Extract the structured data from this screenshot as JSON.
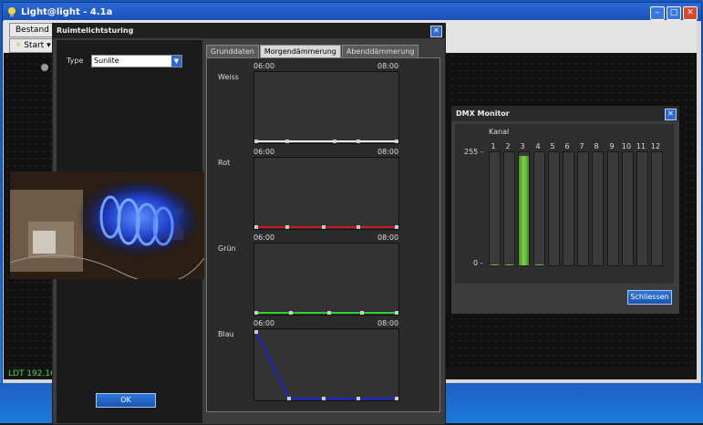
{
  "app": {
    "title": "Light@light - 4.1a"
  },
  "menubar": {
    "bestand_label": "Bestand",
    "start_label": "Start"
  },
  "status": {
    "ip": "LDT 192.168"
  },
  "dialog": {
    "title": "Ruimtelichtsturing",
    "type_label": "Type",
    "type_value": "Sunlite",
    "ok_label": "OK",
    "tabs": [
      "Grunddaten",
      "Morgendämmerung",
      "Abenddämmerung"
    ],
    "active_tab": 1,
    "channels": [
      {
        "name": "Weiss",
        "start": "06:00",
        "end": "08:00",
        "color": "#ffffff",
        "levels": [
          0,
          0,
          0,
          0,
          0
        ]
      },
      {
        "name": "Rot",
        "start": "06:00",
        "end": "08:00",
        "color": "#d01818",
        "levels": [
          0,
          0,
          0,
          0,
          0
        ]
      },
      {
        "name": "Grün",
        "start": "06:00",
        "end": "08:00",
        "color": "#2ad12a",
        "levels": [
          0,
          0,
          0,
          0,
          0
        ]
      },
      {
        "name": "Blau",
        "start": "06:00",
        "end": "08:00",
        "color": "#1a26d6",
        "levels": [
          1,
          0,
          0,
          0,
          0,
          0
        ]
      }
    ]
  },
  "dmx": {
    "title": "DMX Monitor",
    "kanal_label": "Kanal",
    "max_label": "255 -",
    "min_label": "0 -",
    "close_label": "Schliessen",
    "channels": [
      {
        "num": "1",
        "level": 0.01
      },
      {
        "num": "2",
        "level": 0.01
      },
      {
        "num": "3",
        "level": 0.97
      },
      {
        "num": "4",
        "level": 0.01
      },
      {
        "num": "5",
        "level": 0
      },
      {
        "num": "6",
        "level": 0
      },
      {
        "num": "7",
        "level": 0
      },
      {
        "num": "8",
        "level": 0
      },
      {
        "num": "9",
        "level": 0
      },
      {
        "num": "10",
        "level": 0
      },
      {
        "num": "11",
        "level": 0
      },
      {
        "num": "12",
        "level": 0
      }
    ]
  }
}
